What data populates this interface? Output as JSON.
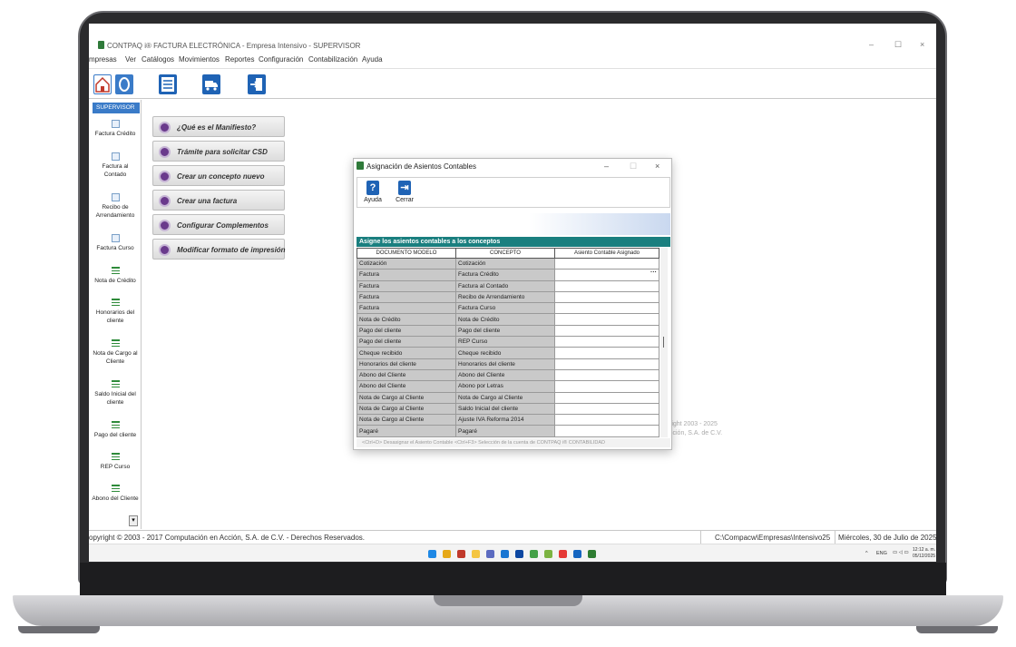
{
  "window": {
    "title": "CONTPAQ i® FACTURA ELECTRÓNICA - Empresa Intensivo - SUPERVISOR",
    "min": "–",
    "max": "☐",
    "close": "×"
  },
  "menu": [
    "mpresas",
    "Ver",
    "Catálogos",
    "Movimientos",
    "Reportes",
    "Configuración",
    "Contabilización",
    "Ayuda"
  ],
  "sidebar": {
    "header": "SUPERVISOR",
    "items": [
      {
        "label": "Factura Crédito",
        "icon": "document-icon"
      },
      {
        "label": "Factura al Contado",
        "icon": "document-icon"
      },
      {
        "label": "Recibo de Arrendamiento",
        "icon": "document-icon"
      },
      {
        "label": "Factura Curso",
        "icon": "document-icon"
      },
      {
        "label": "Nota de Crédito",
        "icon": "list-icon"
      },
      {
        "label": "Honorarios del cliente",
        "icon": "list-icon"
      },
      {
        "label": "Nota de Cargo al Cliente",
        "icon": "list-icon"
      },
      {
        "label": "Saldo Inicial del cliente",
        "icon": "list-icon"
      },
      {
        "label": "Pago del cliente",
        "icon": "list-icon"
      },
      {
        "label": "REP Curso",
        "icon": "list-icon"
      },
      {
        "label": "Abono del Cliente",
        "icon": "list-icon"
      }
    ],
    "scroll_arrow": "▾"
  },
  "help_buttons": [
    "¿Qué es el Manifiesto?",
    "Trámite para solicitar CSD",
    "Crear un concepto nuevo",
    "Crear una factura",
    "Configurar Complementos",
    "Modificar formato de impresión"
  ],
  "background_text": {
    "line1": "right 2003 - 2025",
    "line2": "cción, S.A. de C.V."
  },
  "dialog": {
    "title": "Asignación de Asientos Contables",
    "min": "–",
    "max": "☐",
    "close": "×",
    "toolbar": {
      "help_label": "Ayuda",
      "help_icon": "?",
      "close_label": "Cerrar",
      "close_icon": "⇥"
    },
    "section_header": "Asigne los asientos contables a los conceptos",
    "columns": [
      "DOCUMENTO MODELO",
      "CONCEPTO",
      "Asiento Contable Asignado"
    ],
    "rows": [
      [
        "Cotización",
        "Cotización",
        ""
      ],
      [
        "Factura",
        "Factura Crédito",
        ""
      ],
      [
        "Factura",
        "Factura al Contado",
        ""
      ],
      [
        "Factura",
        "Recibo de Arrendamiento",
        ""
      ],
      [
        "Factura",
        "Factura Curso",
        ""
      ],
      [
        "Nota de Crédito",
        "Nota de Crédito",
        ""
      ],
      [
        "Pago del cliente",
        "Pago del cliente",
        ""
      ],
      [
        "Pago del cliente",
        "REP Curso",
        ""
      ],
      [
        "Cheque recibido",
        "Cheque recibido",
        ""
      ],
      [
        "Honorarios del cliente",
        "Honorarios del cliente",
        ""
      ],
      [
        "Abono del Cliente",
        "Abono del Cliente",
        ""
      ],
      [
        "Abono del Cliente",
        "Abono por Letras",
        ""
      ],
      [
        "Nota de Cargo al Cliente",
        "Nota de Cargo al Cliente",
        ""
      ],
      [
        "Nota de Cargo al Cliente",
        "Saldo Inicial del cliente",
        ""
      ],
      [
        "Nota de Cargo al Cliente",
        "Ajuste IVA Reforma 2014",
        ""
      ],
      [
        "Pagaré",
        "Pagaré",
        ""
      ]
    ],
    "selected_row_button": "···",
    "footer": "<Ctrl+D> Desasignar el Asiento Contable    <Ctrl+F3> Selección de la cuenta de CONTPAQ i® CONTABILIDAD"
  },
  "status": {
    "copyright": "opyright © 2003 - 2017 Computación en Acción, S.A. de C.V. - Derechos Reservados.",
    "path": "C:\\Compacw\\Empresas\\Intensivo25",
    "date": "Miércoles, 30 de Julio de 2025"
  },
  "taskbar": {
    "tray_lang": "ENG",
    "tray_time": "12:12 a. m.",
    "tray_date": "05/12/2025"
  },
  "colors": {
    "accent_blue": "#1f63b5",
    "header_teal": "#1a7f7f",
    "sidebar_head": "#3a7bc8",
    "grid_gray": "#c9c9c9"
  }
}
